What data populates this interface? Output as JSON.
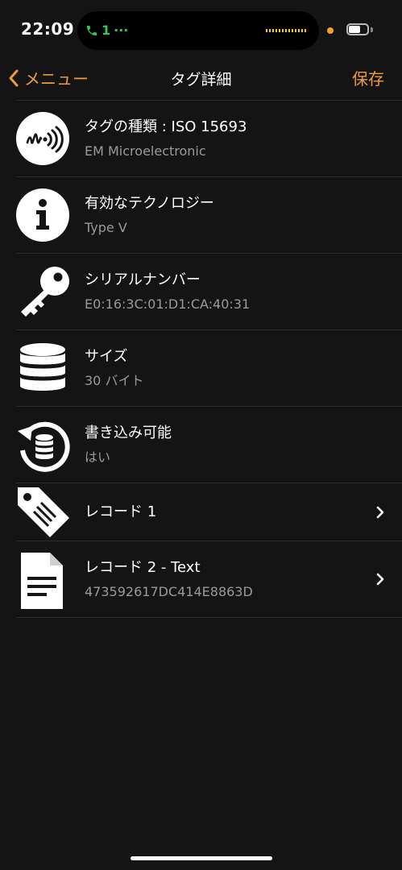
{
  "status_bar": {
    "time": "22:09",
    "call_indicator": "1",
    "battery_level": 0.65,
    "colors": {
      "call": "#34c759",
      "recording_dot": "#f0a030"
    }
  },
  "nav": {
    "back_label": "メニュー",
    "title": "タグ詳細",
    "save_label": "保存",
    "accent_color": "#f09a3e"
  },
  "rows": [
    {
      "icon": "nfc-wave-icon",
      "title": "タグの種類 : ISO 15693",
      "subtitle": "EM Microelectronic"
    },
    {
      "icon": "info-icon",
      "title": "有効なテクノロジー",
      "subtitle": "Type V"
    },
    {
      "icon": "key-icon",
      "title": "シリアルナンバー",
      "subtitle": "E0:16:3C:01:D1:CA:40:31"
    },
    {
      "icon": "database-icon",
      "title": "サイズ",
      "subtitle": "30 バイト"
    },
    {
      "icon": "database-refresh-icon",
      "title": "書き込み可能",
      "subtitle": "はい"
    },
    {
      "icon": "tag-icon",
      "title": "レコード 1",
      "subtitle": ""
    },
    {
      "icon": "document-icon",
      "title": "レコード 2 - Text",
      "subtitle": "473592617DC414E8863D"
    }
  ]
}
